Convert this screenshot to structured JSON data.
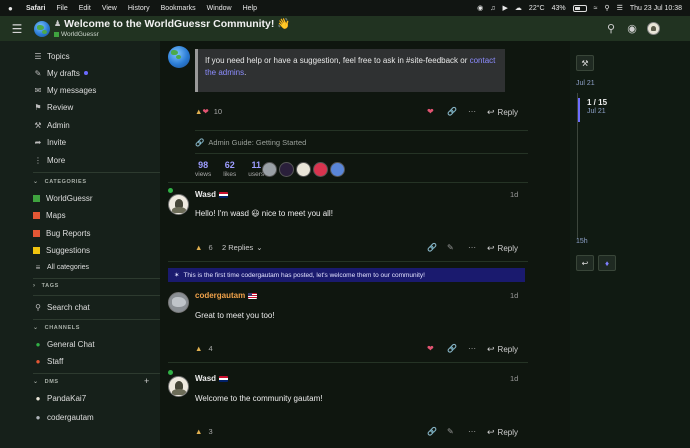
{
  "menubar": {
    "apple": "",
    "items": [
      "Safari",
      "File",
      "Edit",
      "View",
      "History",
      "Bookmarks",
      "Window",
      "Help"
    ],
    "temperature": "22°C",
    "battery": "43%",
    "datetime": "Thu 23 Jul  10:38"
  },
  "header": {
    "title": "Welcome to the WorldGuessr Community! 👋",
    "category": "WorldGuessr"
  },
  "sidebar": {
    "items": [
      {
        "label": "Topics",
        "icon": "layers-icon"
      },
      {
        "label": "My drafts",
        "icon": "draft-icon"
      },
      {
        "label": "My messages",
        "icon": "inbox-icon"
      },
      {
        "label": "Review",
        "icon": "flag-icon"
      },
      {
        "label": "Admin",
        "icon": "wrench-icon"
      },
      {
        "label": "Invite",
        "icon": "share-icon"
      },
      {
        "label": "More",
        "icon": "ellipsis-icon"
      }
    ],
    "categories_heading": "CATEGORIES",
    "categories": [
      {
        "label": "WorldGuessr",
        "color": "#3fa33f"
      },
      {
        "label": "Maps",
        "color": "#e45735"
      },
      {
        "label": "Bug Reports",
        "color": "#e45735"
      },
      {
        "label": "Suggestions",
        "color": "#f1c40f"
      }
    ],
    "all_categories": "All categories",
    "tags_heading": "TAGS",
    "search_chat": "Search chat",
    "channels_heading": "CHANNELS",
    "channels": [
      {
        "label": "General Chat",
        "color": "#31b046"
      },
      {
        "label": "Staff",
        "color": "#e45735"
      }
    ],
    "dms_heading": "DMS",
    "dms": [
      {
        "label": "PandaKai7"
      },
      {
        "label": "codergautam"
      }
    ]
  },
  "first_post": {
    "notice_text": "If you need help or have a suggestion, feel free to ask in #site-feedback or ",
    "notice_link": "contact the admins",
    "notice_end": ".",
    "likes": "10",
    "reply": "Reply",
    "linked_topic": "Admin Guide: Getting Started",
    "stats": [
      {
        "n": "98",
        "l": "views"
      },
      {
        "n": "62",
        "l": "likes"
      },
      {
        "n": "11",
        "l": "users"
      }
    ]
  },
  "posts": [
    {
      "author": "Wasd",
      "date": "1d",
      "body": "Hello! I'm wasd 😃 nice to meet you all!",
      "likes": "6",
      "replies": "2 Replies",
      "reply": "Reply"
    },
    {
      "author": "codergautam",
      "date": "1d",
      "body": "Great to meet you too!",
      "likes": "4",
      "reply": "Reply"
    },
    {
      "author": "Wasd",
      "date": "1d",
      "body": "Welcome to the community gautam!",
      "likes": "3",
      "reply": "Reply"
    }
  ],
  "banner": {
    "text": "This is the first time codergautam has posted, let's welcome them to our community!"
  },
  "timeline": {
    "top_date": "Jul 21",
    "position": "1 / 15",
    "position_date": "Jul 21",
    "bottom_label": "15h"
  },
  "colors": {
    "header_bg": "#213321",
    "accent": "#6e6eff",
    "like": "#e25472"
  }
}
